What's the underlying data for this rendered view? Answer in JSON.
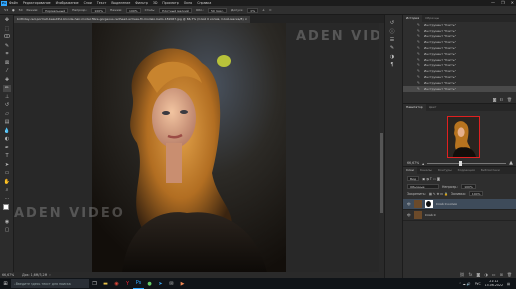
{
  "menu": {
    "logo": "Ps",
    "items": [
      "Файл",
      "Редактирование",
      "Изображение",
      "Слои",
      "Текст",
      "Выделение",
      "Фильтр",
      "3D",
      "Просмотр",
      "Окно",
      "Справка"
    ]
  },
  "window_controls": {
    "min": "—",
    "max": "❐",
    "close": "✕"
  },
  "options": {
    "size": "50",
    "mode_label": "Режим:",
    "mode_value": "Нормальный",
    "opacity_label": "Непрозр.:",
    "opacity_value": "100%",
    "pressure_label": "Нажим:",
    "pressure_value": "100%",
    "style_label": "Стиль:",
    "style_value": "Плотный мелкий",
    "area_label": "Обл.:",
    "area_value": "50 пикс.",
    "tolerance_label": "Допуск:",
    "tolerance_value": "0%"
  },
  "document_tab": {
    "title": "birthday-red-portrait-beautiful-blonde-hair-model-fibre-gorgeous-redhead-actress-fir-modelo-bello-182067.jpg @ 66,7% (Слой 0 копия, Слой-маска/8)",
    "close": "×"
  },
  "watermark": {
    "text": "ADEN VIDEO"
  },
  "status": {
    "zoom": "66,67%",
    "doc": "Док: 1,6M/3,2M"
  },
  "history": {
    "tab_active": "История",
    "tab_other": "Образцы",
    "items": [
      "Инструмент \"Кисть\"",
      "Инструмент \"Кисть\"",
      "Инструмент \"Кисть\"",
      "Инструмент \"Кисть\"",
      "Инструмент \"Кисть\"",
      "Инструмент \"Кисть\"",
      "Инструмент \"Кисть\"",
      "Инструмент \"Кисть\"",
      "Инструмент \"Кисть\"",
      "Инструмент \"Кисть\"",
      "Инструмент \"Кисть\"",
      "Инструмент \"Кисть\""
    ]
  },
  "navigator": {
    "tab_active": "Навигатор",
    "tab_other": "Цвет",
    "zoom": "66,67%"
  },
  "layers": {
    "tabs": [
      "Слои",
      "Каналы",
      "Контуры",
      "Коррекция",
      "Библиотеки"
    ],
    "active_tab": "Слои",
    "kind_label": "Вид",
    "blend_mode": "Обычные",
    "opacity_label": "Непрозр.:",
    "opacity_value": "100%",
    "lock_label": "Закрепить:",
    "fill_label": "Заливка:",
    "fill_value": "100%",
    "items": [
      {
        "name": "Слой 0 копия",
        "selected": true
      },
      {
        "name": "Слой 0",
        "selected": false
      }
    ]
  },
  "taskbar": {
    "search_placeholder": "Введите здесь текст для поиска",
    "time": "21:12",
    "date": "15.06.2022",
    "lang": "РУС"
  },
  "colors": {
    "accent": "#31a8ff",
    "nav_frame": "#e02020",
    "layer_selected": "#3e4b5a"
  }
}
